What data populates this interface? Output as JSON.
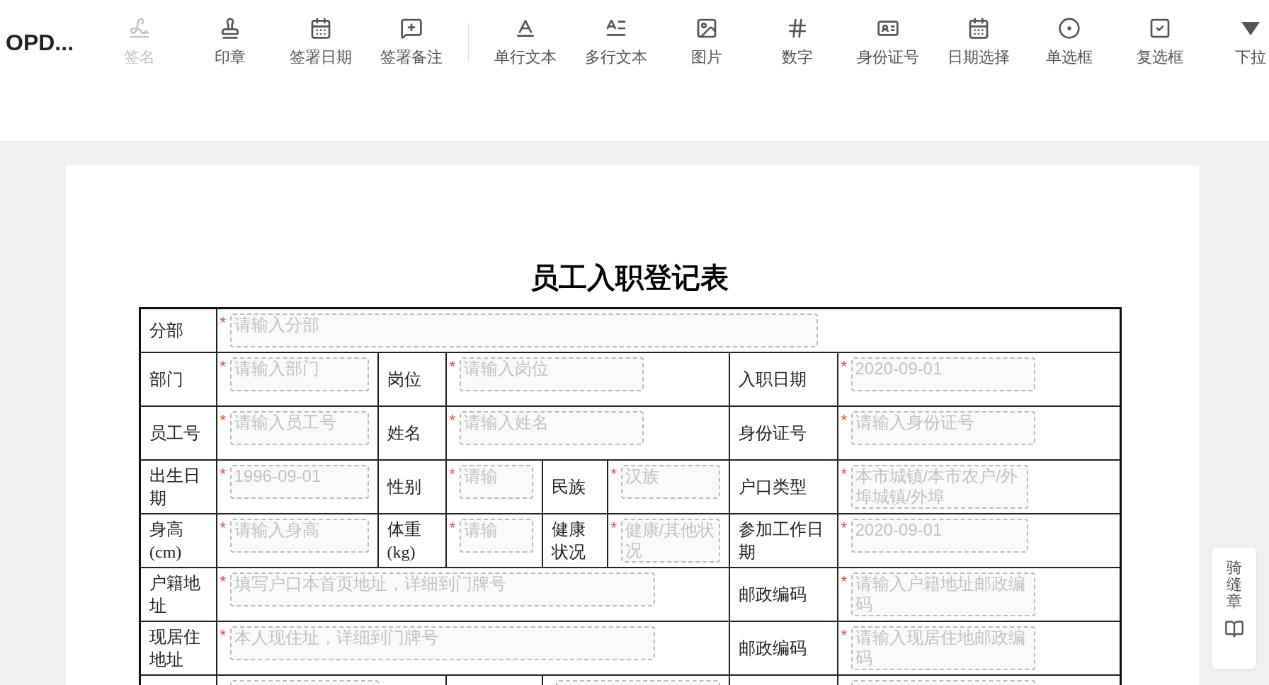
{
  "app_title": "OPD...",
  "toolbar": {
    "groups": [
      [
        {
          "label": "签名",
          "kind": "signature",
          "disabled": true
        },
        {
          "label": "印章",
          "kind": "stamp",
          "disabled": false
        },
        {
          "label": "签署日期",
          "kind": "date",
          "disabled": false
        },
        {
          "label": "签署备注",
          "kind": "note",
          "disabled": false
        }
      ],
      [
        {
          "label": "单行文本",
          "kind": "text",
          "disabled": false
        },
        {
          "label": "多行文本",
          "kind": "multitext",
          "disabled": false
        },
        {
          "label": "图片",
          "kind": "image",
          "disabled": false
        },
        {
          "label": "数字",
          "kind": "number",
          "disabled": false
        },
        {
          "label": "身份证号",
          "kind": "idcard",
          "disabled": false
        },
        {
          "label": "日期选择",
          "kind": "date",
          "disabled": false
        },
        {
          "label": "单选框",
          "kind": "radio",
          "disabled": false
        },
        {
          "label": "复选框",
          "kind": "checkbox",
          "disabled": false
        },
        {
          "label": "下拉",
          "kind": "dropdown",
          "disabled": false
        }
      ]
    ]
  },
  "form": {
    "title": "员工入职登记表",
    "rows": [
      {
        "kind": "wide",
        "cells": [
          {
            "kind": "label",
            "text": "分部"
          },
          {
            "kind": "field",
            "colspan": 7,
            "placeholder": "请输入分部",
            "mark": "*"
          }
        ]
      },
      {
        "kind": "triple",
        "cells": [
          {
            "kind": "label",
            "text": "部门"
          },
          {
            "kind": "field",
            "placeholder": "请输入部门",
            "mark": "*"
          },
          {
            "kind": "label",
            "text": "岗位"
          },
          {
            "kind": "field",
            "colspan": 3,
            "placeholder": "请输入岗位",
            "mark": "*"
          },
          {
            "kind": "label",
            "text": "入职日期"
          },
          {
            "kind": "field",
            "placeholder": "2020-09-01",
            "mark": "*"
          }
        ]
      },
      {
        "kind": "triple",
        "cells": [
          {
            "kind": "label",
            "text": "员工号"
          },
          {
            "kind": "field",
            "placeholder": "请输入员工号",
            "mark": "*"
          },
          {
            "kind": "label",
            "text": "姓名"
          },
          {
            "kind": "field",
            "colspan": 3,
            "placeholder": "请输入姓名",
            "mark": "*"
          },
          {
            "kind": "label",
            "text": "身份证号"
          },
          {
            "kind": "field",
            "placeholder": "请输入身份证号",
            "mark": "*"
          }
        ]
      },
      {
        "kind": "quad",
        "cells": [
          {
            "kind": "label",
            "text": "出生日期"
          },
          {
            "kind": "field",
            "placeholder": "1996-09-01",
            "mark": "*"
          },
          {
            "kind": "label",
            "text": "性别"
          },
          {
            "kind": "field",
            "placeholder": "请输",
            "mark": "*"
          },
          {
            "kind": "label",
            "text": "民族"
          },
          {
            "kind": "field",
            "placeholder": "汉族",
            "mark": "*"
          },
          {
            "kind": "label",
            "text": "户口类型"
          },
          {
            "kind": "field",
            "placeholder": "本市城镇/本市农户/外埠城镇/外埠",
            "mark": "*"
          }
        ]
      },
      {
        "kind": "quad",
        "cells": [
          {
            "kind": "label",
            "text": "身高(cm)"
          },
          {
            "kind": "field",
            "placeholder": "请输入身高",
            "mark": "*"
          },
          {
            "kind": "label",
            "text": "体重(kg)"
          },
          {
            "kind": "field",
            "placeholder": "请输",
            "mark": "*"
          },
          {
            "kind": "label",
            "text": "健康状况"
          },
          {
            "kind": "field",
            "placeholder": "健康/其他状况",
            "mark": "*"
          },
          {
            "kind": "label",
            "text": "参加工作日期"
          },
          {
            "kind": "field",
            "placeholder": "2020-09-01",
            "mark": "*"
          }
        ]
      },
      {
        "kind": "address",
        "cells": [
          {
            "kind": "label",
            "text": "户籍地址"
          },
          {
            "kind": "field",
            "colspan": 5,
            "placeholder": "填写户口本首页地址，详细到门牌号",
            "mark": "*"
          },
          {
            "kind": "label",
            "text": "邮政编码"
          },
          {
            "kind": "field",
            "placeholder": "请输入户籍地址邮政编码",
            "mark": "*"
          }
        ]
      },
      {
        "kind": "address",
        "cells": [
          {
            "kind": "label",
            "text": "现居住地址"
          },
          {
            "kind": "field",
            "colspan": 5,
            "placeholder": "本人现住址，详细到门牌号",
            "mark": "*"
          },
          {
            "kind": "label",
            "text": "邮政编码"
          },
          {
            "kind": "field",
            "placeholder": "请输入现居住地邮政编码",
            "mark": "*"
          }
        ]
      },
      {
        "kind": "phone",
        "cells": [
          {
            "kind": "label"
          },
          {
            "kind": "field",
            "colspan": 2
          },
          {
            "kind": "label"
          },
          {
            "kind": "field",
            "colspan": 2
          },
          {
            "kind": "label"
          },
          {
            "kind": "field"
          }
        ]
      }
    ]
  },
  "side_tool": {
    "label": "骑缝章"
  }
}
